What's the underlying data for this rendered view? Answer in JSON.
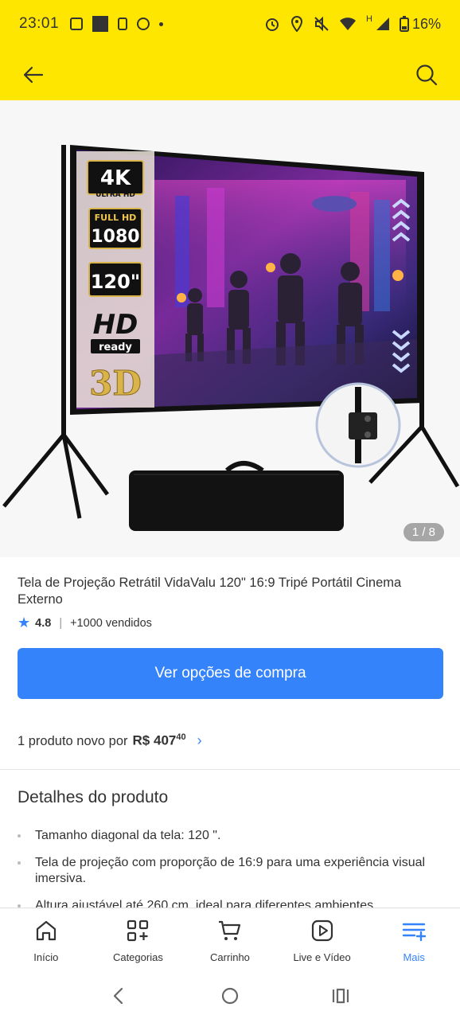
{
  "status_bar": {
    "time": "23:01",
    "battery": "16%",
    "network": "H"
  },
  "gallery": {
    "counter": "1 / 8",
    "badges": [
      "4K",
      "ULTRA HD",
      "FULL HD",
      "1080",
      "120\"",
      "HD",
      "ready",
      "3D"
    ]
  },
  "product": {
    "title": "Tela de Projeção Retrátil VidaValu 120\" 16:9 Tripé Portátil Cinema Externo",
    "rating": "4.8",
    "sold": "+1000 vendidos",
    "buy_button": "Ver opções de compra",
    "offer_text": "1 produto novo por",
    "price_currency": "R$",
    "price_integer": "407",
    "price_cents": "40"
  },
  "details": {
    "title": "Detalhes do produto",
    "items": [
      "Tamanho diagonal da tela: 120 \".",
      "Tela de projeção com proporção de 16:9 para uma experiência visual imersiva.",
      "Altura ajustável até 260 cm, ideal para diferentes ambientes"
    ]
  },
  "bottom_nav": {
    "items": [
      {
        "label": "Início",
        "icon": "home-icon"
      },
      {
        "label": "Categorias",
        "icon": "categories-icon"
      },
      {
        "label": "Carrinho",
        "icon": "cart-icon"
      },
      {
        "label": "Live e Vídeo",
        "icon": "play-icon"
      },
      {
        "label": "Mais",
        "icon": "menu-plus-icon"
      }
    ],
    "active_index": 4
  },
  "colors": {
    "brand_yellow": "#ffe600",
    "accent_blue": "#3483fa"
  }
}
